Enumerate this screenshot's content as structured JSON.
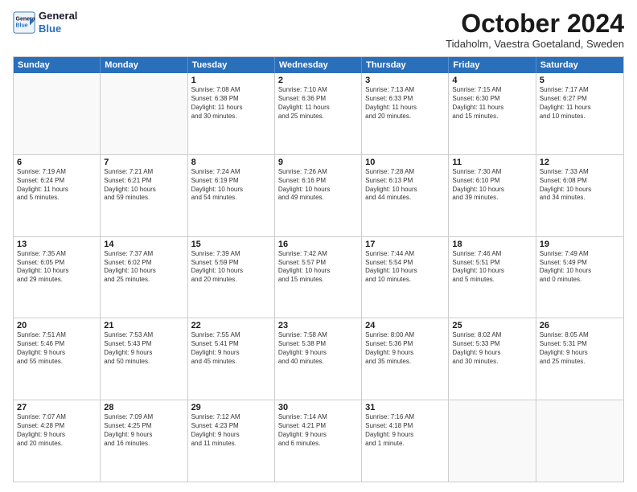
{
  "logo": {
    "line1": "General",
    "line2": "Blue"
  },
  "title": "October 2024",
  "location": "Tidaholm, Vaestra Goetaland, Sweden",
  "days": [
    "Sunday",
    "Monday",
    "Tuesday",
    "Wednesday",
    "Thursday",
    "Friday",
    "Saturday"
  ],
  "weeks": [
    [
      {
        "day": "",
        "lines": []
      },
      {
        "day": "",
        "lines": []
      },
      {
        "day": "1",
        "lines": [
          "Sunrise: 7:08 AM",
          "Sunset: 6:38 PM",
          "Daylight: 11 hours",
          "and 30 minutes."
        ]
      },
      {
        "day": "2",
        "lines": [
          "Sunrise: 7:10 AM",
          "Sunset: 6:36 PM",
          "Daylight: 11 hours",
          "and 25 minutes."
        ]
      },
      {
        "day": "3",
        "lines": [
          "Sunrise: 7:13 AM",
          "Sunset: 6:33 PM",
          "Daylight: 11 hours",
          "and 20 minutes."
        ]
      },
      {
        "day": "4",
        "lines": [
          "Sunrise: 7:15 AM",
          "Sunset: 6:30 PM",
          "Daylight: 11 hours",
          "and 15 minutes."
        ]
      },
      {
        "day": "5",
        "lines": [
          "Sunrise: 7:17 AM",
          "Sunset: 6:27 PM",
          "Daylight: 11 hours",
          "and 10 minutes."
        ]
      }
    ],
    [
      {
        "day": "6",
        "lines": [
          "Sunrise: 7:19 AM",
          "Sunset: 6:24 PM",
          "Daylight: 11 hours",
          "and 5 minutes."
        ]
      },
      {
        "day": "7",
        "lines": [
          "Sunrise: 7:21 AM",
          "Sunset: 6:21 PM",
          "Daylight: 10 hours",
          "and 59 minutes."
        ]
      },
      {
        "day": "8",
        "lines": [
          "Sunrise: 7:24 AM",
          "Sunset: 6:19 PM",
          "Daylight: 10 hours",
          "and 54 minutes."
        ]
      },
      {
        "day": "9",
        "lines": [
          "Sunrise: 7:26 AM",
          "Sunset: 6:16 PM",
          "Daylight: 10 hours",
          "and 49 minutes."
        ]
      },
      {
        "day": "10",
        "lines": [
          "Sunrise: 7:28 AM",
          "Sunset: 6:13 PM",
          "Daylight: 10 hours",
          "and 44 minutes."
        ]
      },
      {
        "day": "11",
        "lines": [
          "Sunrise: 7:30 AM",
          "Sunset: 6:10 PM",
          "Daylight: 10 hours",
          "and 39 minutes."
        ]
      },
      {
        "day": "12",
        "lines": [
          "Sunrise: 7:33 AM",
          "Sunset: 6:08 PM",
          "Daylight: 10 hours",
          "and 34 minutes."
        ]
      }
    ],
    [
      {
        "day": "13",
        "lines": [
          "Sunrise: 7:35 AM",
          "Sunset: 6:05 PM",
          "Daylight: 10 hours",
          "and 29 minutes."
        ]
      },
      {
        "day": "14",
        "lines": [
          "Sunrise: 7:37 AM",
          "Sunset: 6:02 PM",
          "Daylight: 10 hours",
          "and 25 minutes."
        ]
      },
      {
        "day": "15",
        "lines": [
          "Sunrise: 7:39 AM",
          "Sunset: 5:59 PM",
          "Daylight: 10 hours",
          "and 20 minutes."
        ]
      },
      {
        "day": "16",
        "lines": [
          "Sunrise: 7:42 AM",
          "Sunset: 5:57 PM",
          "Daylight: 10 hours",
          "and 15 minutes."
        ]
      },
      {
        "day": "17",
        "lines": [
          "Sunrise: 7:44 AM",
          "Sunset: 5:54 PM",
          "Daylight: 10 hours",
          "and 10 minutes."
        ]
      },
      {
        "day": "18",
        "lines": [
          "Sunrise: 7:46 AM",
          "Sunset: 5:51 PM",
          "Daylight: 10 hours",
          "and 5 minutes."
        ]
      },
      {
        "day": "19",
        "lines": [
          "Sunrise: 7:49 AM",
          "Sunset: 5:49 PM",
          "Daylight: 10 hours",
          "and 0 minutes."
        ]
      }
    ],
    [
      {
        "day": "20",
        "lines": [
          "Sunrise: 7:51 AM",
          "Sunset: 5:46 PM",
          "Daylight: 9 hours",
          "and 55 minutes."
        ]
      },
      {
        "day": "21",
        "lines": [
          "Sunrise: 7:53 AM",
          "Sunset: 5:43 PM",
          "Daylight: 9 hours",
          "and 50 minutes."
        ]
      },
      {
        "day": "22",
        "lines": [
          "Sunrise: 7:55 AM",
          "Sunset: 5:41 PM",
          "Daylight: 9 hours",
          "and 45 minutes."
        ]
      },
      {
        "day": "23",
        "lines": [
          "Sunrise: 7:58 AM",
          "Sunset: 5:38 PM",
          "Daylight: 9 hours",
          "and 40 minutes."
        ]
      },
      {
        "day": "24",
        "lines": [
          "Sunrise: 8:00 AM",
          "Sunset: 5:36 PM",
          "Daylight: 9 hours",
          "and 35 minutes."
        ]
      },
      {
        "day": "25",
        "lines": [
          "Sunrise: 8:02 AM",
          "Sunset: 5:33 PM",
          "Daylight: 9 hours",
          "and 30 minutes."
        ]
      },
      {
        "day": "26",
        "lines": [
          "Sunrise: 8:05 AM",
          "Sunset: 5:31 PM",
          "Daylight: 9 hours",
          "and 25 minutes."
        ]
      }
    ],
    [
      {
        "day": "27",
        "lines": [
          "Sunrise: 7:07 AM",
          "Sunset: 4:28 PM",
          "Daylight: 9 hours",
          "and 20 minutes."
        ]
      },
      {
        "day": "28",
        "lines": [
          "Sunrise: 7:09 AM",
          "Sunset: 4:25 PM",
          "Daylight: 9 hours",
          "and 16 minutes."
        ]
      },
      {
        "day": "29",
        "lines": [
          "Sunrise: 7:12 AM",
          "Sunset: 4:23 PM",
          "Daylight: 9 hours",
          "and 11 minutes."
        ]
      },
      {
        "day": "30",
        "lines": [
          "Sunrise: 7:14 AM",
          "Sunset: 4:21 PM",
          "Daylight: 9 hours",
          "and 6 minutes."
        ]
      },
      {
        "day": "31",
        "lines": [
          "Sunrise: 7:16 AM",
          "Sunset: 4:18 PM",
          "Daylight: 9 hours",
          "and 1 minute."
        ]
      },
      {
        "day": "",
        "lines": []
      },
      {
        "day": "",
        "lines": []
      }
    ]
  ]
}
